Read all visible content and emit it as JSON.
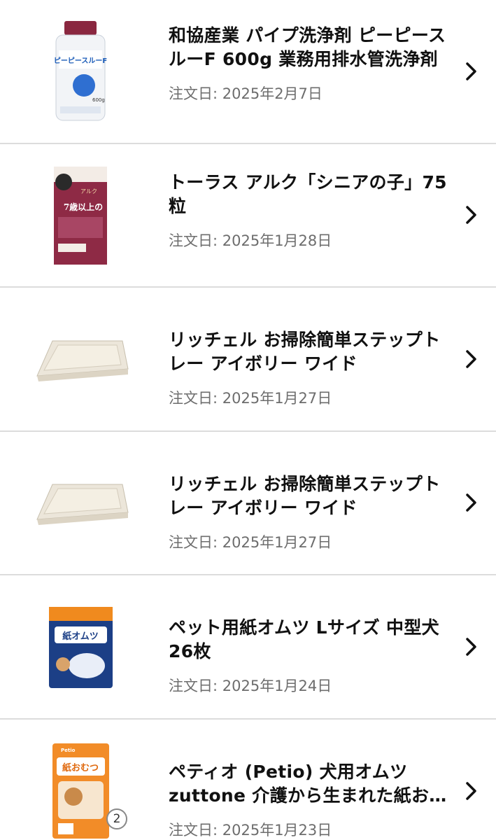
{
  "orders": [
    {
      "title": "和協産業 パイプ洗浄剤 ピーピースルーF 600g 業務用排水管洗浄剤",
      "date": "注文日: 2025年2月7日",
      "product_image": "pipe-cleaner-bottle-image",
      "bottle_label": "ピーピースルーF",
      "bottle_weight": "600g"
    },
    {
      "title": "トーラス アルク「シニアの子」75粒",
      "date": "注文日: 2025年1月28日",
      "product_image": "senior-dog-supplement-box-image",
      "box_headline": "7歳以上の",
      "box_brand": "アルク"
    },
    {
      "title": "リッチェル お掃除簡単ステップトレー アイボリー ワイド",
      "date": "注文日: 2025年1月27日",
      "product_image": "pet-toilet-tray-image"
    },
    {
      "title": "リッチェル お掃除簡単ステップトレー アイボリー ワイド",
      "date": "注文日: 2025年1月27日",
      "product_image": "pet-toilet-tray-image"
    },
    {
      "title": "ペット用紙オムツ Lサイズ 中型犬 26枚",
      "date": "注文日: 2025年1月24日",
      "product_image": "pet-diaper-pack-image",
      "pack_label": "紙オムツ"
    },
    {
      "title": "ペティオ (Petio) 犬用オムツ zuttone 介護から生まれた紙おむつ",
      "date": "注文日: 2025年1月23日",
      "product_image": "petio-diaper-pack-image",
      "pack_label": "紙おむつ",
      "pack_brand": "Petio",
      "quantity": "2"
    }
  ],
  "icons": {
    "chevron": "chevron-right-icon"
  },
  "colors": {
    "text": "#111111",
    "date": "#6d6d6d",
    "divider": "#dcdcdc"
  }
}
